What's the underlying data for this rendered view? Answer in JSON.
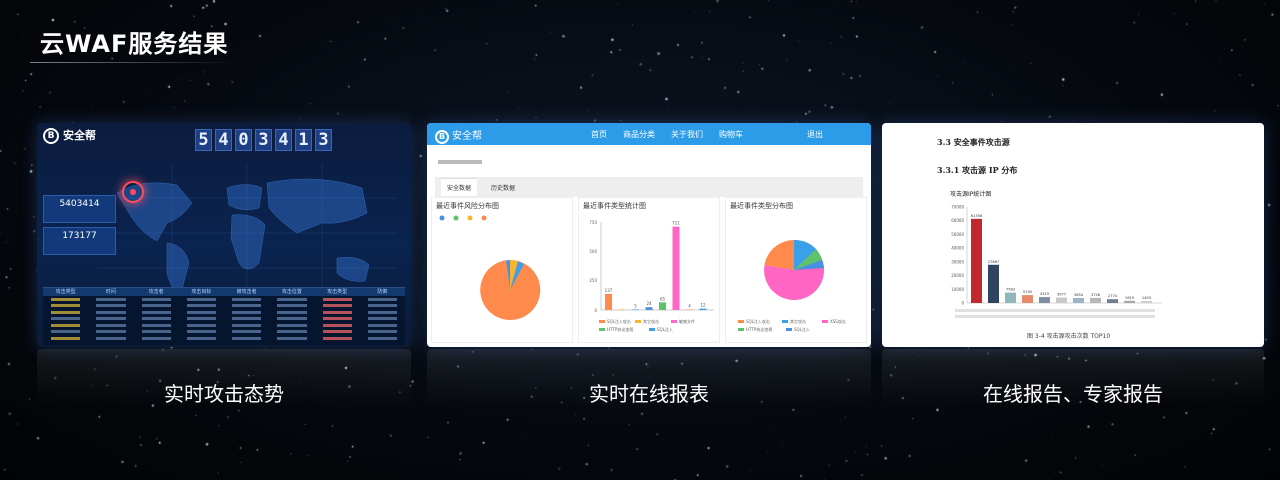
{
  "header": {
    "title": "云WAF服务结果"
  },
  "captions": [
    "实时攻击态势",
    "实时在线报表",
    "在线报告、专家报告"
  ],
  "card1": {
    "logo": "安全帮",
    "digits": [
      "5",
      "4",
      "0",
      "3",
      "4",
      "1",
      "3"
    ],
    "stats": [
      {
        "value": "5403414"
      },
      {
        "value": "173177"
      }
    ],
    "table_headers": [
      "攻击类型",
      "时间",
      "攻击者",
      "攻击目标",
      "被攻击者",
      "攻击位置",
      "攻击类型",
      "防御"
    ]
  },
  "card2": {
    "logo": "安全帮",
    "nav": [
      "首页",
      "商品分类",
      "关于我们",
      "购物车",
      "退出"
    ],
    "tabs": [
      "安全数据",
      "历史数据"
    ],
    "panels": [
      {
        "title": "最近事件风险分布图"
      },
      {
        "title": "最近事件类型统计图"
      },
      {
        "title": "最近事件类型分布图"
      }
    ],
    "bar_chart": {
      "type": "bar",
      "y_ticks": [
        "750",
        "500",
        "250",
        "0"
      ],
      "values": [
        137,
        5,
        5,
        24,
        65,
        711,
        4,
        12
      ],
      "value_labels": [
        "137",
        "",
        "5",
        "24",
        "65",
        "711",
        "4",
        "12"
      ]
    },
    "legend_labels": [
      "SQL注入攻击",
      "其它攻击",
      "敏感文件",
      "XSS攻击",
      "HTTP协议违规",
      "SQL注入"
    ]
  },
  "card3": {
    "heading_1": "3.3  安全事件攻击源",
    "heading_2": "3.3.1  攻击源 IP 分布",
    "chart_title": "攻击源IP统计图",
    "y_ticks": [
      "70000",
      "60000",
      "50000",
      "40000",
      "30000",
      "20000",
      "10000",
      "0"
    ],
    "bar_values": [
      "61356",
      "27867",
      "7583",
      "5740",
      "4319",
      "3977",
      "3654",
      "3726",
      "2774",
      "1619",
      "1493"
    ],
    "caption": "图 3-4  攻击源攻击次数 TOP10",
    "chart_data": {
      "type": "bar",
      "title": "攻击源IP统计图",
      "values": [
        61356,
        27867,
        7583,
        5740,
        4319,
        3977,
        3654,
        3726,
        2774,
        1619,
        1493
      ],
      "ylim": [
        0,
        70000
      ]
    }
  },
  "colors": {
    "accent_blue": "#2c9be8",
    "dark_red": "#c0282d",
    "pie_orange": "#ff8a4c",
    "pie_pink": "#ff66c4"
  }
}
